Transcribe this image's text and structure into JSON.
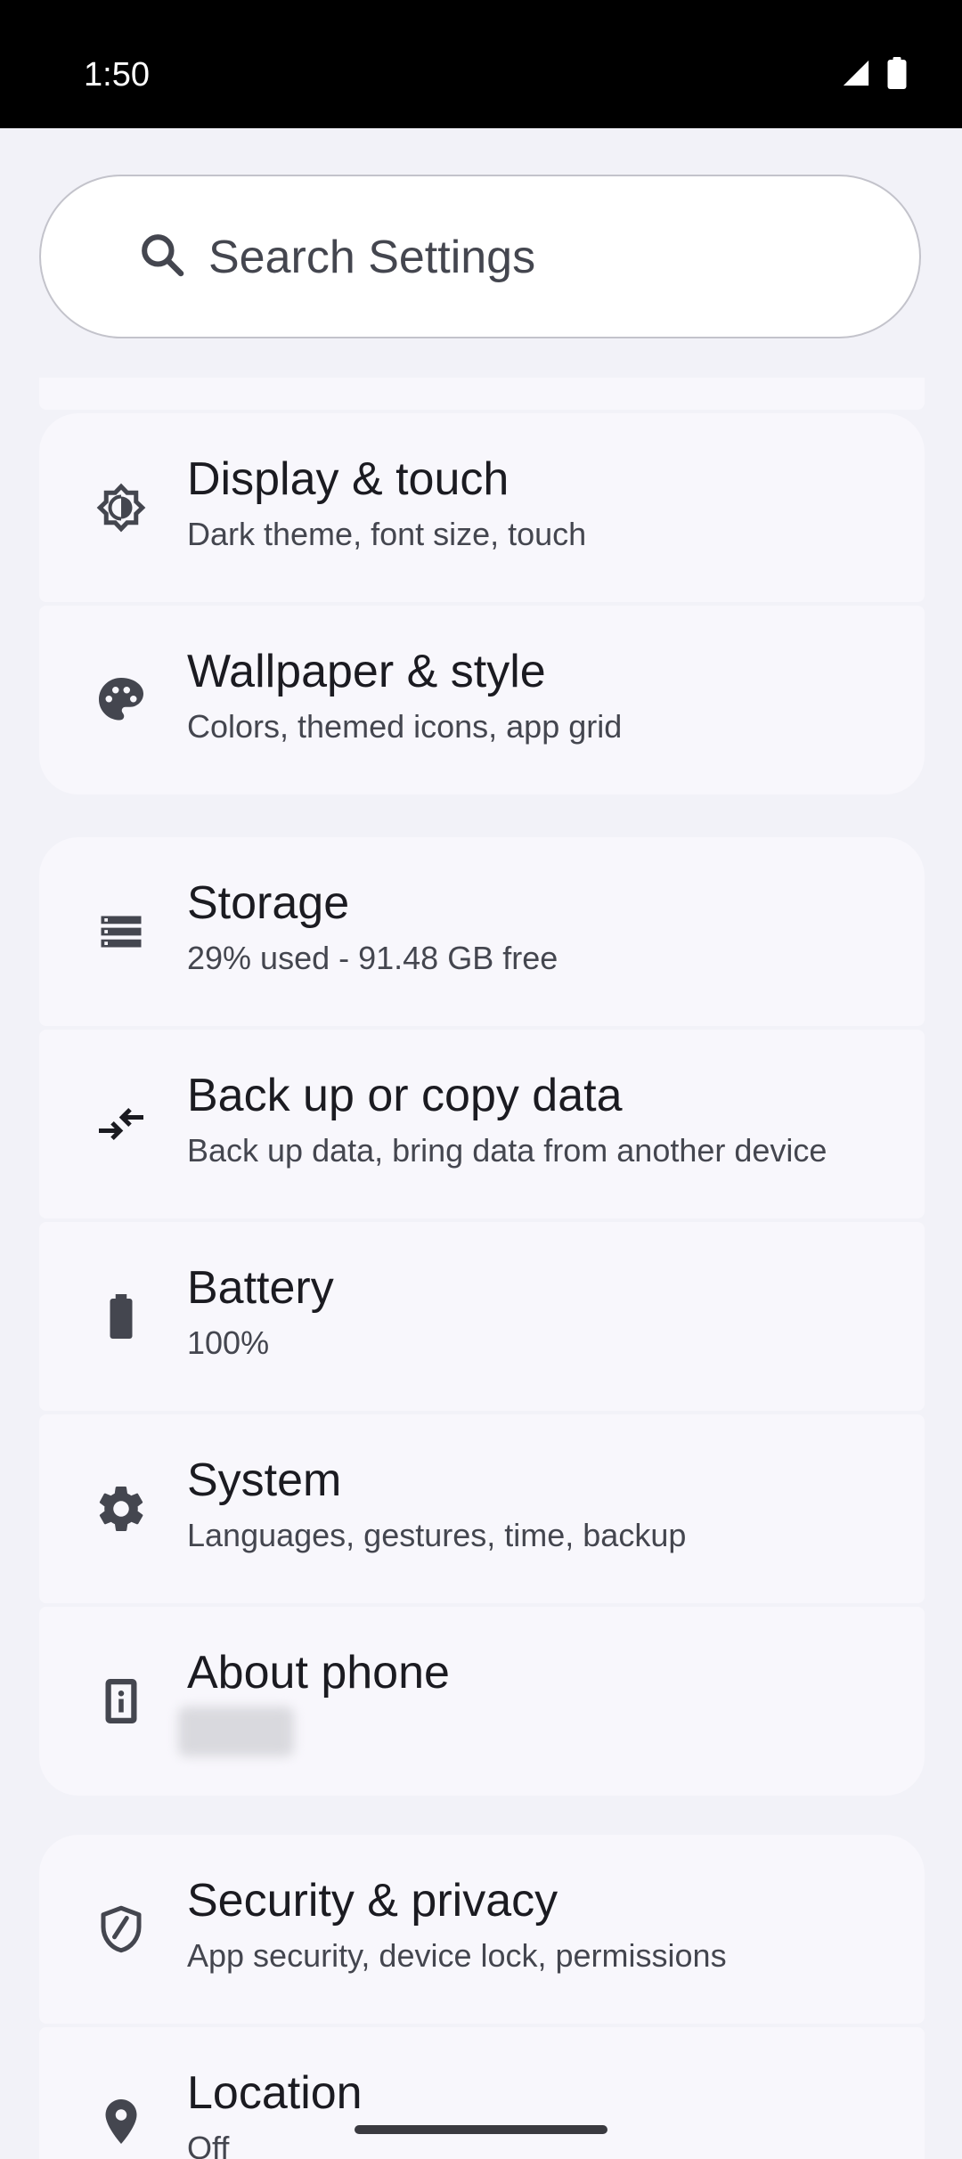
{
  "status_bar": {
    "time": "1:50",
    "icons": [
      "signal-icon",
      "battery-icon"
    ]
  },
  "search": {
    "placeholder": "Search Settings",
    "icon": "search-icon"
  },
  "groups": [
    {
      "items": [
        {
          "icon": "brightness-icon",
          "title": "Display & touch",
          "subtitle": "Dark theme, font size, touch"
        },
        {
          "icon": "palette-icon",
          "title": "Wallpaper & style",
          "subtitle": "Colors, themed icons, app grid"
        }
      ]
    },
    {
      "items": [
        {
          "icon": "storage-icon",
          "title": "Storage",
          "subtitle": "29% used - 91.48 GB free"
        },
        {
          "icon": "transfer-icon",
          "title": "Back up or copy data",
          "subtitle": "Back up data, bring data from another device"
        },
        {
          "icon": "battery-icon",
          "title": "Battery",
          "subtitle": "100%"
        },
        {
          "icon": "gear-icon",
          "title": "System",
          "subtitle": "Languages, gestures, time, backup"
        },
        {
          "icon": "phone-info-icon",
          "title": "About phone",
          "subtitle": ""
        }
      ]
    },
    {
      "items": [
        {
          "icon": "shield-icon",
          "title": "Security & privacy",
          "subtitle": "App security, device lock, permissions"
        },
        {
          "icon": "location-pin-icon",
          "title": "Location",
          "subtitle": "Off"
        }
      ]
    }
  ],
  "colors": {
    "background": "#F2F2F8",
    "card": "#F8F7FC",
    "text_primary": "#1B1B21",
    "text_secondary": "#44464F",
    "icon": "#44464F"
  }
}
